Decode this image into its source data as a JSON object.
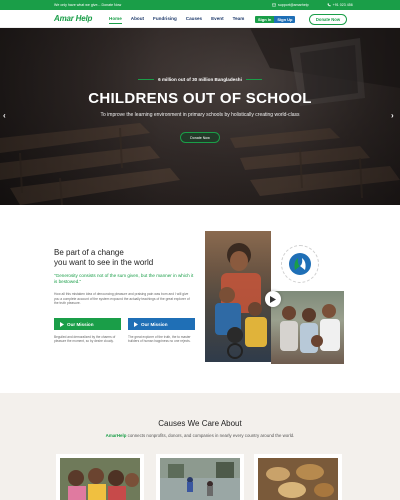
{
  "topbar": {
    "tagline": "We only have what we give... Donate Now",
    "email": "support@amarhelp",
    "phone": "+91 023 456"
  },
  "nav": {
    "logo": "Amar Help",
    "items": [
      "Home",
      "About",
      "Fundrising",
      "Causes",
      "Event",
      "Team"
    ],
    "signin": "Sign In",
    "signup": "Sign Up",
    "donate": "Donate Now"
  },
  "hero": {
    "subtitle": "6 million out of 30 million Bangladeshi",
    "title": "CHILDRENS OUT OF SCHOOL",
    "description": "To improve the learning environment in primary schools by holistically creating world-class",
    "cta": "Donate Now",
    "prev_arrow": "‹",
    "next_arrow": "›"
  },
  "mission": {
    "title_line1": "Be part of a change",
    "title_line2": "you want to see in the world",
    "quote": "\"Generosity consists not of the sum given, but the manner in which it is bestowed.\"",
    "body": "How all this mistaken idea of denouncing pleasure and praising pain was born and I will give you a complete account of the system expound the actually teachings of the great explorer of the truth pleasure.",
    "btn_mission": "Our Mission",
    "btn_mission_blue": "Our Mission",
    "caption1": "Beguiled and demoralized by the charms of pleasure the moment, so by desire cloudy.",
    "caption2": "The great explorer of the truth, the to master builders of human happiness no one rejects."
  },
  "causes": {
    "title": "Causes We Care About",
    "brand": "AmarHelp",
    "subtitle": "connects nonprofits, donors, and companies in nearly every country around the world."
  },
  "colors": {
    "green": "#1a9e48",
    "blue": "#1f6fb6",
    "navy": "#1e3a6b"
  },
  "icons": {
    "email": "mail-icon",
    "phone": "phone-icon",
    "play": "play-icon",
    "chevron": "chevron-right-icon"
  }
}
